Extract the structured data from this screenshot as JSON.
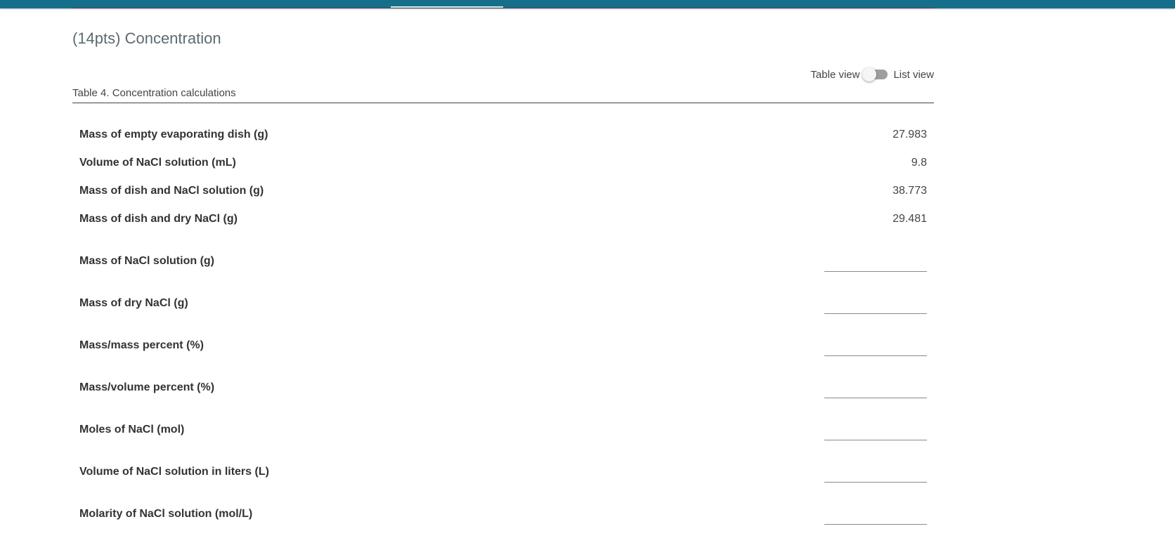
{
  "header": {
    "accent_color": "#156f8b"
  },
  "section": {
    "title": "(14pts) Concentration"
  },
  "view_toggle": {
    "left_label": "Table view",
    "right_label": "List view",
    "state": "off"
  },
  "table": {
    "caption": "Table 4. Concentration calculations",
    "given": [
      {
        "label": "Mass of empty evaporating dish (g)",
        "value": "27.983"
      },
      {
        "label": "Volume of NaCl solution (mL)",
        "value": "9.8"
      },
      {
        "label": "Mass of dish and NaCl solution (g)",
        "value": "38.773"
      },
      {
        "label": "Mass of dish and dry NaCl (g)",
        "value": "29.481"
      }
    ],
    "inputs": [
      {
        "label": "Mass of NaCl solution (g)",
        "value": ""
      },
      {
        "label": "Mass of dry NaCl (g)",
        "value": ""
      },
      {
        "label": "Mass/mass percent (%)",
        "value": ""
      },
      {
        "label": "Mass/volume percent (%)",
        "value": ""
      },
      {
        "label": "Moles of NaCl (mol)",
        "value": ""
      },
      {
        "label": "Volume of NaCl solution in liters (L)",
        "value": ""
      },
      {
        "label": "Molarity of NaCl solution (mol/L)",
        "value": ""
      }
    ]
  }
}
